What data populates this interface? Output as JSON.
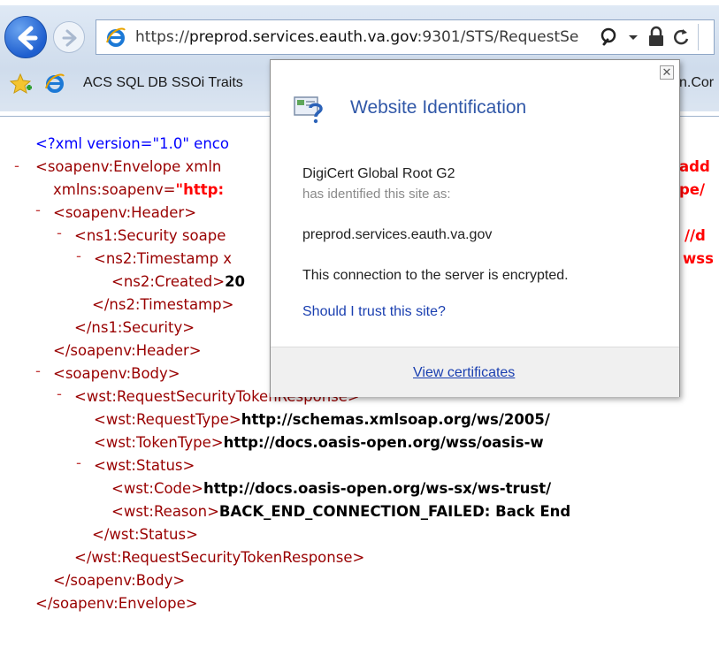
{
  "browser": {
    "url_prefix": "https://",
    "url_host": "preprod.services.eauth.va.gov",
    "url_rest": ":9301/STS/RequestSe",
    "favorites_item": "ACS SQL DB SSOi Traits",
    "favorites_right_fragment": "n.Cor"
  },
  "popup": {
    "title": "Website Identification",
    "issuer": "DigiCert Global Root G2",
    "identified_text": "has identified this site as:",
    "site": "preprod.services.eauth.va.gov",
    "encryption": "This connection to the server is encrypted.",
    "trust_link": "Should I trust this site?",
    "view_certificates": "View certificates",
    "close_symbol": "✕"
  },
  "xml": {
    "line1": "<?xml version=\"1.0\" enco",
    "envelope_open": "<soapenv:Envelope xmln",
    "envelope_right": "add",
    "envelope_attr_name": "xmlns:soapenv=",
    "envelope_attr_val": "\"http:",
    "envelope_attr_right": "pe/",
    "header_open": "<soapenv:Header>",
    "security_open": "<ns1:Security soape",
    "security_right": "//d",
    "timestamp_open": "<ns2:Timestamp x",
    "timestamp_right": "wss",
    "created_tag": "<ns2:Created>",
    "created_val": "20",
    "timestamp_close": "</ns2:Timestamp>",
    "security_close": "</ns1:Security>",
    "header_close": "</soapenv:Header>",
    "body_open": "<soapenv:Body>",
    "rstr_open": "<wst:RequestSecurityTokenResponse>",
    "requesttype_tag": "<wst:RequestType>",
    "requesttype_val": "http://schemas.xmlsoap.org/ws/2005/",
    "tokentype_tag": "<wst:TokenType>",
    "tokentype_val": "http://docs.oasis-open.org/wss/oasis-w",
    "status_open": "<wst:Status>",
    "code_tag": "<wst:Code>",
    "code_val": "http://docs.oasis-open.org/ws-sx/ws-trust/",
    "reason_tag": "<wst:Reason>",
    "reason_val": "BACK_END_CONNECTION_FAILED: Back End",
    "status_close": "</wst:Status>",
    "rstr_close": "</wst:RequestSecurityTokenResponse>",
    "body_close": "</soapenv:Body>",
    "envelope_close": "</soapenv:Envelope>"
  },
  "colors": {
    "tag": "#990000",
    "bracket": "#0000ff",
    "attr_value": "#ff0000",
    "link": "#1a3fb0"
  }
}
